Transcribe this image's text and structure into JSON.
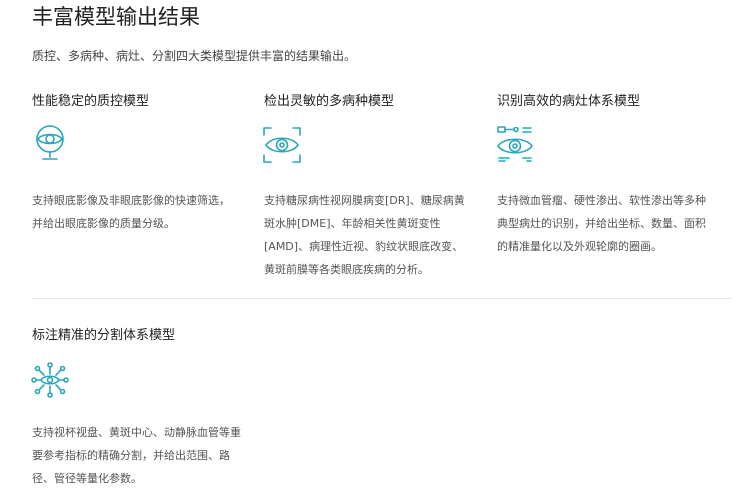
{
  "page": {
    "title": "丰富模型输出结果",
    "subtitle": "质控、多病种、病灶、分割四大类模型提供丰富的结果输出。"
  },
  "accent_color": "#2aa7b8",
  "cards": [
    {
      "title": "性能稳定的质控模型",
      "icon": "eye-monitor-icon",
      "desc": "支持眼底影像及非眼底影像的快速筛选，并给出眼底影像的质量分级。"
    },
    {
      "title": "检出灵敏的多病种模型",
      "icon": "eye-scan-icon",
      "desc": "支持糖尿病性视网膜病变[DR]、糖尿病黄斑水肿[DME]、年龄相关性黄斑变性[AMD]、病理性近视、豹纹状眼底改变、黄斑前膜等各类眼底疾病的分析。"
    },
    {
      "title": "识别高效的病灶体系模型",
      "icon": "eye-detect-icon",
      "desc": "支持微血管瘤、硬性渗出、软性渗出等多种典型病灶的识别，并给出坐标、数量、面积的精准量化以及外观轮廓的圈画。"
    },
    {
      "title": "标注精准的分割体系模型",
      "icon": "eye-network-icon",
      "desc": "支持视杯视盘、黄斑中心、动静脉血管等重要参考指标的精确分割，并给出范围、路径、管径等量化参数。"
    }
  ]
}
